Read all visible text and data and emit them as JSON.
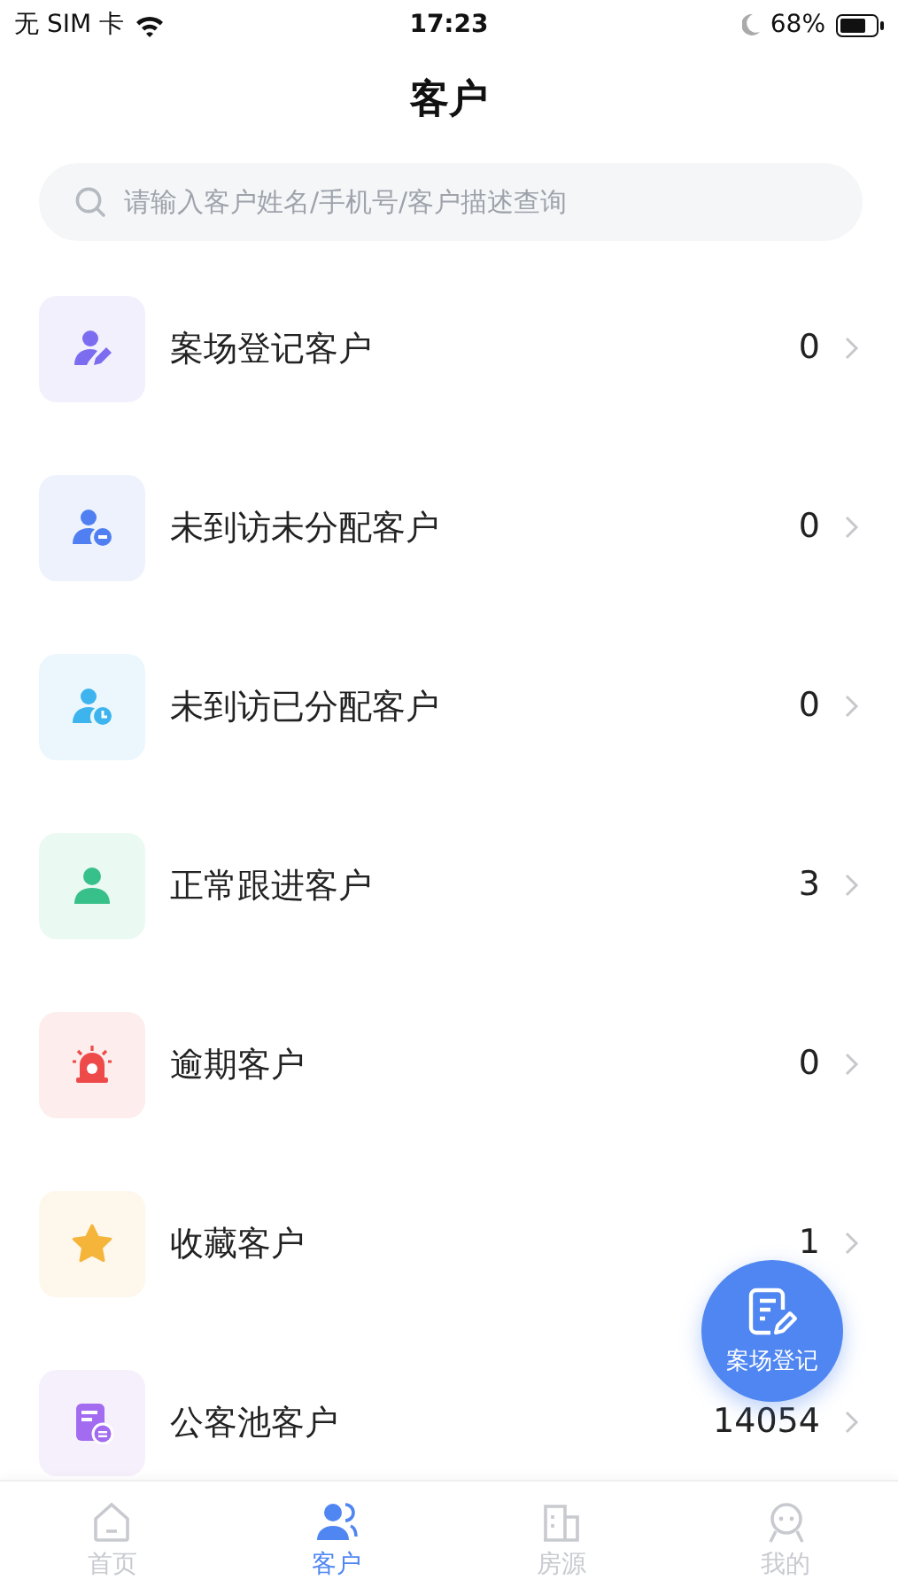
{
  "status_bar": {
    "carrier": "无 SIM 卡",
    "time": "17:23",
    "battery": "68%"
  },
  "header": {
    "title": "客户"
  },
  "search": {
    "placeholder": "请输入客户姓名/手机号/客户描述查询"
  },
  "rows": [
    {
      "kind": "register",
      "color": "#7b6cf0",
      "label": "案场登记客户",
      "count": "0"
    },
    {
      "kind": "unassigned",
      "color": "#4f7ff0",
      "label": "未到访未分配客户",
      "count": "0"
    },
    {
      "kind": "assigned",
      "color": "#3db4ee",
      "label": "未到访已分配客户",
      "count": "0"
    },
    {
      "kind": "normal",
      "color": "#38c08a",
      "label": "正常跟进客户",
      "count": "3"
    },
    {
      "kind": "overdue",
      "color": "#ee4a4a",
      "label": "逾期客户",
      "count": "0"
    },
    {
      "kind": "favorite",
      "color": "#f5b43a",
      "label": "收藏客户",
      "count": "1"
    },
    {
      "kind": "pool",
      "color": "#a36cf0",
      "label": "公客池客户",
      "count": "14054"
    }
  ],
  "fab": {
    "label": "案场登记"
  },
  "tabs": [
    {
      "label": "首页",
      "selected": false
    },
    {
      "label": "客户",
      "selected": true
    },
    {
      "label": "房源",
      "selected": false
    },
    {
      "label": "我的",
      "selected": false
    }
  ]
}
